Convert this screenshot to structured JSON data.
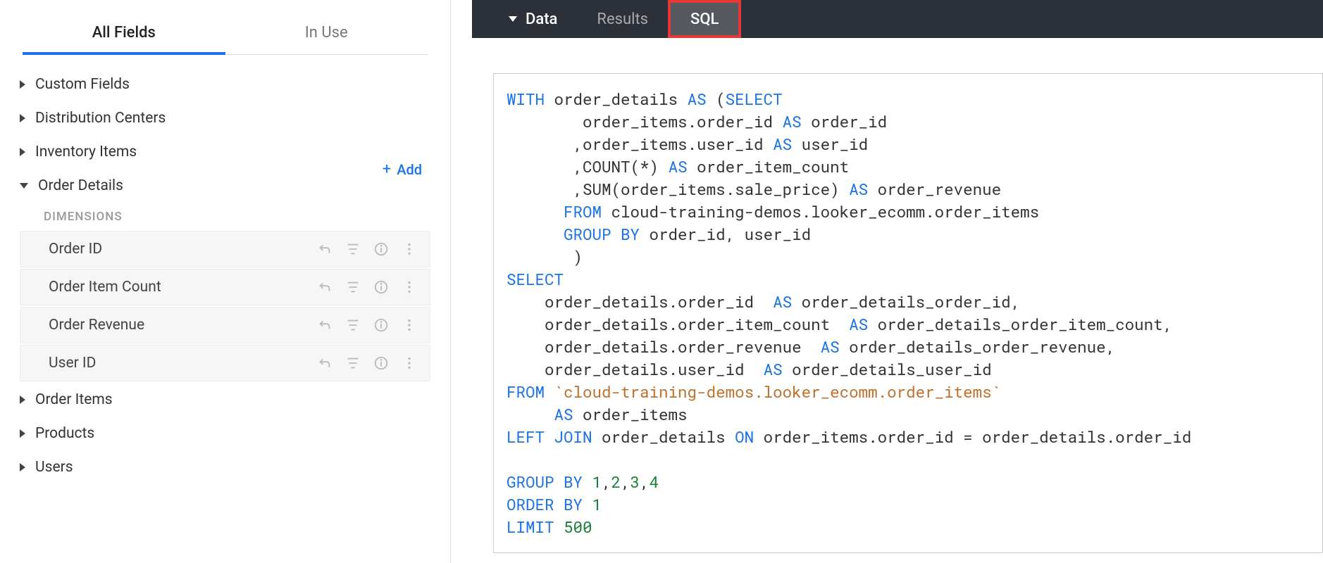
{
  "sidebar": {
    "tabs": {
      "all_fields": "All Fields",
      "in_use": "In Use"
    },
    "add_label": "Add",
    "tree": {
      "custom_fields": "Custom Fields",
      "distribution_centers": "Distribution Centers",
      "inventory_items": "Inventory Items",
      "order_details": "Order Details",
      "order_items": "Order Items",
      "products": "Products",
      "users": "Users"
    },
    "dimensions_header": "DIMENSIONS",
    "dimensions": {
      "order_id": "Order ID",
      "order_item_count": "Order Item Count",
      "order_revenue": "Order Revenue",
      "user_id": "User ID"
    }
  },
  "topbar": {
    "data": "Data",
    "results": "Results",
    "sql": "SQL"
  },
  "sql": {
    "with": "WITH",
    "t01": " order_details ",
    "as": "AS",
    "lp": " (",
    "select": "SELECT",
    "t02": "        order_items.order_id ",
    "t03": " order_id",
    "t04": "       ,order_items.user_id ",
    "t05": " user_id",
    "t06": "       ,",
    "count": "COUNT",
    "t07": "(*) ",
    "t08": " order_item_count",
    "t09": "       ,",
    "sum": "SUM",
    "t10": "(order_items.sale_price) ",
    "t11": " order_revenue",
    "t12": "      ",
    "from": "FROM",
    "t13": " cloud-training-demos.looker_ecomm.order_items",
    "group_by": "GROUP BY",
    "t14": " order_id, user_id",
    "t15": "       )",
    "t16": "    order_details.order_id  ",
    "t17": " order_details_order_id,",
    "t18": "    order_details.order_item_count  ",
    "t19": " order_details_order_item_count,",
    "t20": "    order_details.order_revenue  ",
    "t21": " order_details_order_revenue,",
    "t22": "    order_details.user_id  ",
    "t23": " order_details_user_id",
    "t_from2pad": " ",
    "t_str": "`cloud-training-demos.looker_ecomm.order_items`",
    "t24": "     ",
    "t25": " order_items",
    "left_join": "LEFT JOIN",
    "t26": " order_details ",
    "on": "ON",
    "t27": " order_items.order_id = order_details.order_id",
    "t28": " ",
    "order_by": "ORDER BY",
    "t29": " ",
    "limit": "LIMIT",
    "t30": " ",
    "g1": "1",
    "c12": ",",
    "g2": "2",
    "c23": ",",
    "g3": "3",
    "c34": ",",
    "g4": "4",
    "o1": "1",
    "l500": "500"
  }
}
